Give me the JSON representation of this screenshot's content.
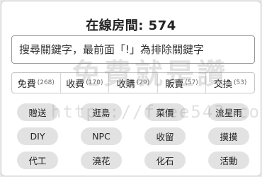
{
  "header": {
    "title": "在線房間: 574"
  },
  "search": {
    "placeholder": "搜尋關鍵字，最前面「!」為排除關鍵字",
    "value": ""
  },
  "tabs": [
    {
      "label": "免費",
      "count": "(268)"
    },
    {
      "label": "收費",
      "count": "(170)"
    },
    {
      "label": "收購",
      "count": "(29)"
    },
    {
      "label": "販賣",
      "count": "(57)"
    },
    {
      "label": "交換",
      "count": "(53)"
    }
  ],
  "tags": [
    "贈送",
    "逛島",
    "菜價",
    "流星雨",
    "DIY",
    "NPC",
    "收留",
    "摸摸",
    "代工",
    "澆花",
    "化石",
    "活動"
  ],
  "watermark": {
    "line1": "免費就是讚",
    "line2": "https://free543.com"
  }
}
